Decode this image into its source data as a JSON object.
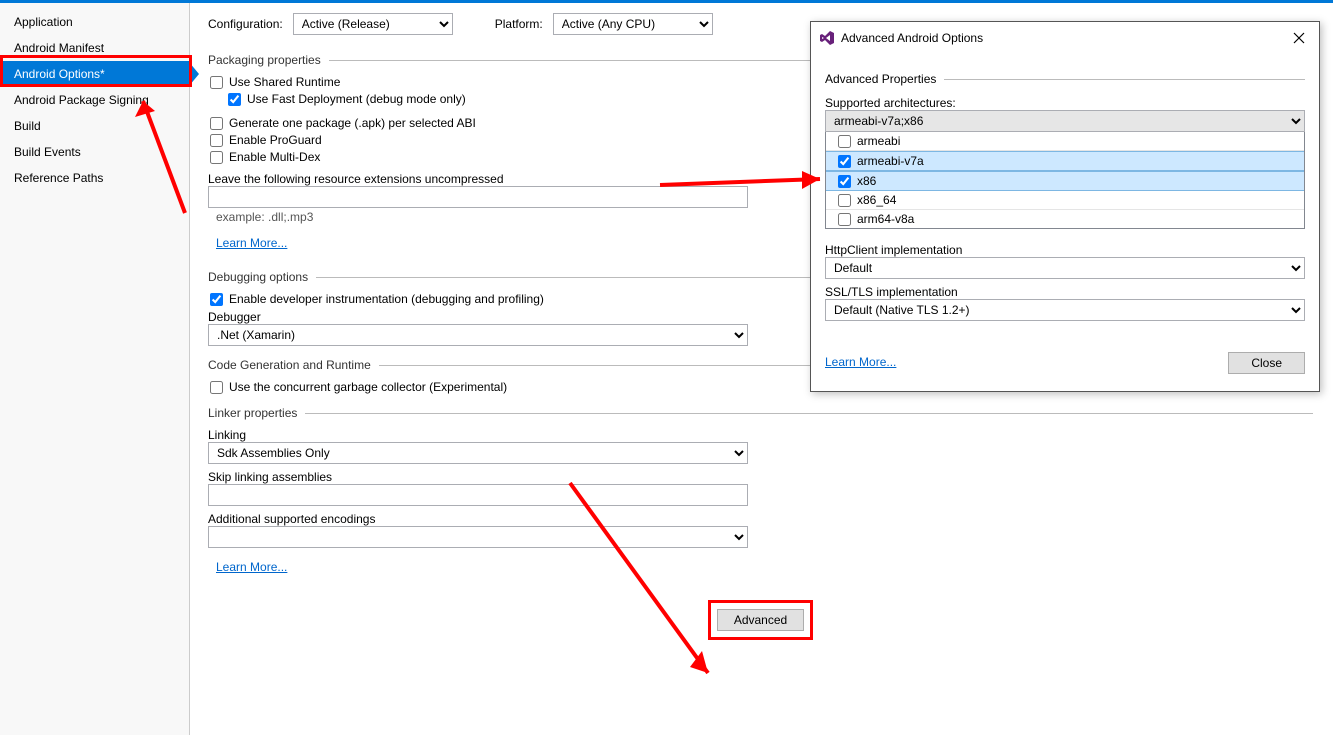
{
  "sidebar": {
    "items": [
      {
        "label": "Application"
      },
      {
        "label": "Android Manifest"
      },
      {
        "label": "Android Options*"
      },
      {
        "label": "Android Package Signing"
      },
      {
        "label": "Build"
      },
      {
        "label": "Build Events"
      },
      {
        "label": "Reference Paths"
      }
    ]
  },
  "config": {
    "configuration_label": "Configuration:",
    "configuration_value": "Active (Release)",
    "platform_label": "Platform:",
    "platform_value": "Active (Any CPU)"
  },
  "packaging": {
    "title": "Packaging properties",
    "use_shared_runtime": "Use Shared Runtime",
    "use_fast_deploy": "Use Fast Deployment (debug mode only)",
    "one_pkg_per_abi": "Generate one package (.apk) per selected ABI",
    "enable_proguard": "Enable ProGuard",
    "enable_multidex": "Enable Multi-Dex",
    "uncompressed_label": "Leave the following resource extensions uncompressed",
    "uncompressed_value": "",
    "uncompressed_hint": "example: .dll;.mp3",
    "learn_more": "Learn More..."
  },
  "debugging": {
    "title": "Debugging options",
    "enable_dev_instr": "Enable developer instrumentation (debugging and profiling)",
    "debugger_label": "Debugger",
    "debugger_value": ".Net (Xamarin)"
  },
  "codegen": {
    "title": "Code Generation and Runtime",
    "concurrent_gc": "Use the concurrent garbage collector (Experimental)"
  },
  "linker": {
    "title": "Linker properties",
    "linking_label": "Linking",
    "linking_value": "Sdk Assemblies Only",
    "skip_label": "Skip linking assemblies",
    "skip_value": "",
    "encodings_label": "Additional supported encodings",
    "encodings_value": "",
    "learn_more": "Learn More..."
  },
  "advanced_btn": "Advanced",
  "dialog": {
    "title": "Advanced Android Options",
    "section_title": "Advanced Properties",
    "arch_label": "Supported architectures:",
    "arch_value": "armeabi-v7a;x86",
    "arch_items": [
      {
        "label": "armeabi",
        "checked": false,
        "selected": false
      },
      {
        "label": "armeabi-v7a",
        "checked": true,
        "selected": true
      },
      {
        "label": "x86",
        "checked": true,
        "selected": true
      },
      {
        "label": "x86_64",
        "checked": false,
        "selected": false
      },
      {
        "label": "arm64-v8a",
        "checked": false,
        "selected": false
      }
    ],
    "httpclient_label": "HttpClient implementation",
    "httpclient_value": "Default",
    "ssl_label": "SSL/TLS implementation",
    "ssl_value": "Default (Native TLS 1.2+)",
    "learn_more": "Learn More...",
    "close": "Close"
  }
}
